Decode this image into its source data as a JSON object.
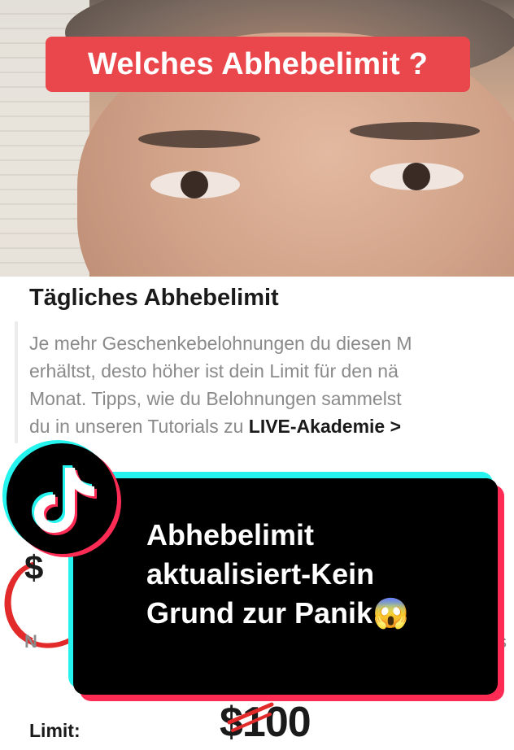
{
  "video": {
    "top_caption": "Welches Abhebelimit ?"
  },
  "card": {
    "title": "Tägliches Abhebelimit",
    "description_lines": [
      "Je mehr Geschenkebelohnungen du diesen M",
      "erhältst, desto höher ist dein Limit für den nä",
      "Monat. Tipps, wie du Belohnungen sammelst",
      "du in unseren Tutorials zu "
    ],
    "link_text": "LIVE-Akademie",
    "link_chevron": ">",
    "partial_currency": "$",
    "partial_label_left": "N",
    "partial_label_right": "s",
    "limit_label": "Limit:",
    "limit_value": "$100"
  },
  "overlay": {
    "lines": [
      "Abhebelimit",
      "aktualisiert-Kein",
      "Grund zur Panik😱"
    ],
    "logo_icon": "tiktok-logo-icon"
  },
  "colors": {
    "pill_red": "#e9474b",
    "tiktok_cyan": "#25f4ee",
    "tiktok_red": "#fe2c55",
    "text_dark": "#1a1a1a",
    "text_gray": "#8a8a8a"
  }
}
